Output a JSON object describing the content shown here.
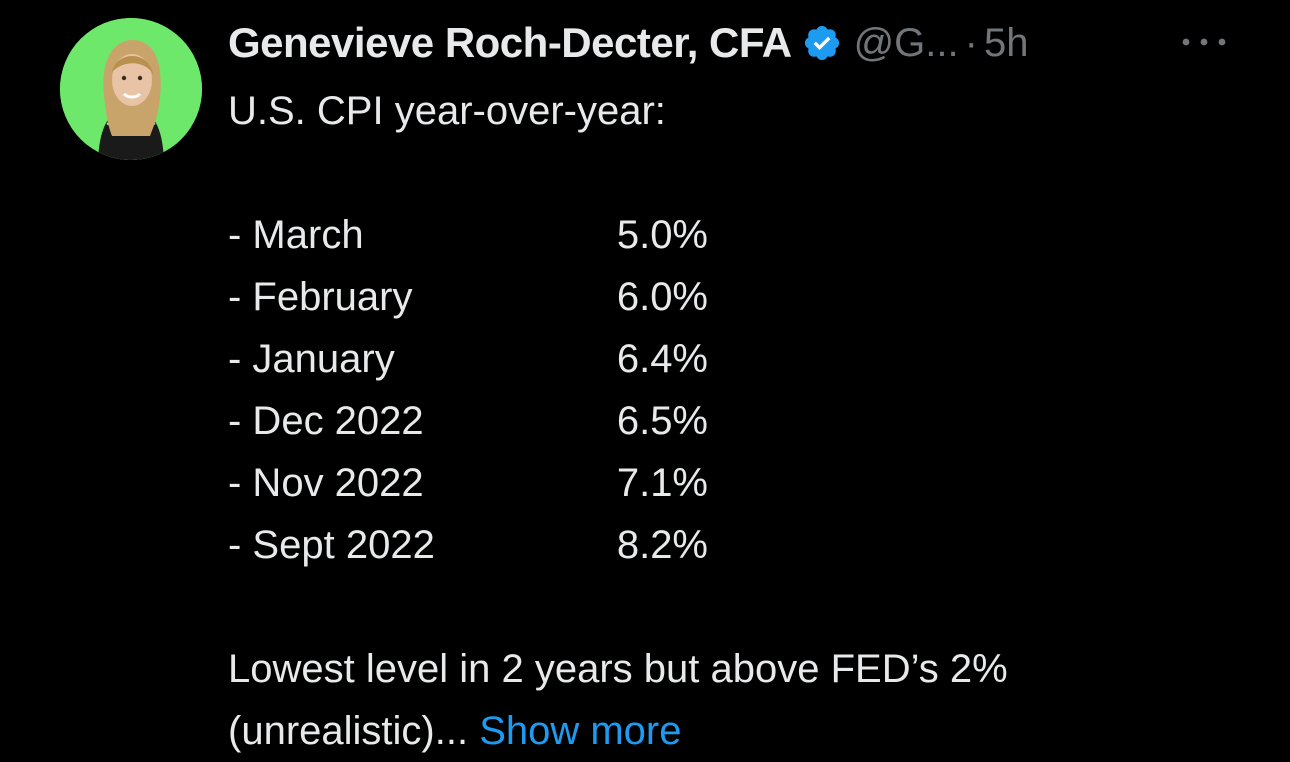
{
  "tweet": {
    "display_name": "Genevieve Roch-Decter, CFA",
    "handle": "@G...",
    "separator": "·",
    "time": "5h",
    "intro": "U.S. CPI year-over-year:",
    "rows": [
      {
        "label": "- March",
        "value": "5.0%"
      },
      {
        "label": "- February",
        "value": "6.0%"
      },
      {
        "label": "- January",
        "value": "6.4%"
      },
      {
        "label": "- Dec 2022",
        "value": "6.5%"
      },
      {
        "label": "- Nov 2022",
        "value": "7.1%"
      },
      {
        "label": "- Sept 2022",
        "value": "8.2%"
      }
    ],
    "footer_line1": "Lowest level in 2 years but above FED’s 2%",
    "footer_line2": "(unrealistic)...",
    "show_more": "Show more"
  },
  "icons": {
    "verified": "verified-badge-icon",
    "more": "more-horizontal-icon"
  },
  "colors": {
    "background": "#000000",
    "text": "#e7e9ea",
    "muted": "#71767b",
    "link": "#1d9bf0",
    "verified": "#1d9bf0",
    "avatar_bg": "#6ee86a"
  }
}
